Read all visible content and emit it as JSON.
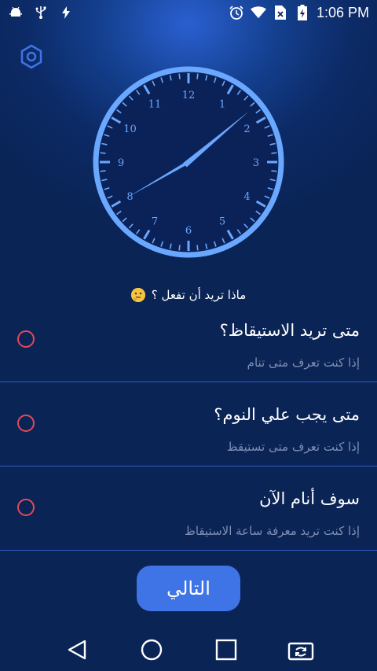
{
  "status_bar": {
    "time": "1:06 PM",
    "left_icons": [
      "android-debug-icon",
      "usb-icon",
      "flash-icon"
    ],
    "right_icons": [
      "alarm-icon",
      "wifi-icon",
      "no-sim-icon",
      "battery-charging-icon"
    ]
  },
  "clock": {
    "numbers": [
      "12",
      "1",
      "2",
      "3",
      "4",
      "5",
      "6",
      "7",
      "8",
      "9",
      "10",
      "11"
    ],
    "hour": 1,
    "minute": 40,
    "color": "#6aa8ff"
  },
  "prompt": {
    "text": "ماذا تريد أن تفعل ؟",
    "emoji": "thinking-face"
  },
  "options": [
    {
      "title": "متى تريد الاستيقاظ؟",
      "subtitle": "إذا كنت تعرف متى تنام"
    },
    {
      "title": "متى يجب علي النوم؟",
      "subtitle": "إذا كنت تعرف متى تستيقظ"
    },
    {
      "title": "سوف أنام الآن",
      "subtitle": "إذا كنت تريد معرفة ساعة الاستيقاظ"
    }
  ],
  "next_button": {
    "label": "التالي"
  },
  "colors": {
    "background": "#0a2456",
    "accent": "#3f74e6",
    "radio": "#e04a5a",
    "divider": "#2e5fc4"
  }
}
